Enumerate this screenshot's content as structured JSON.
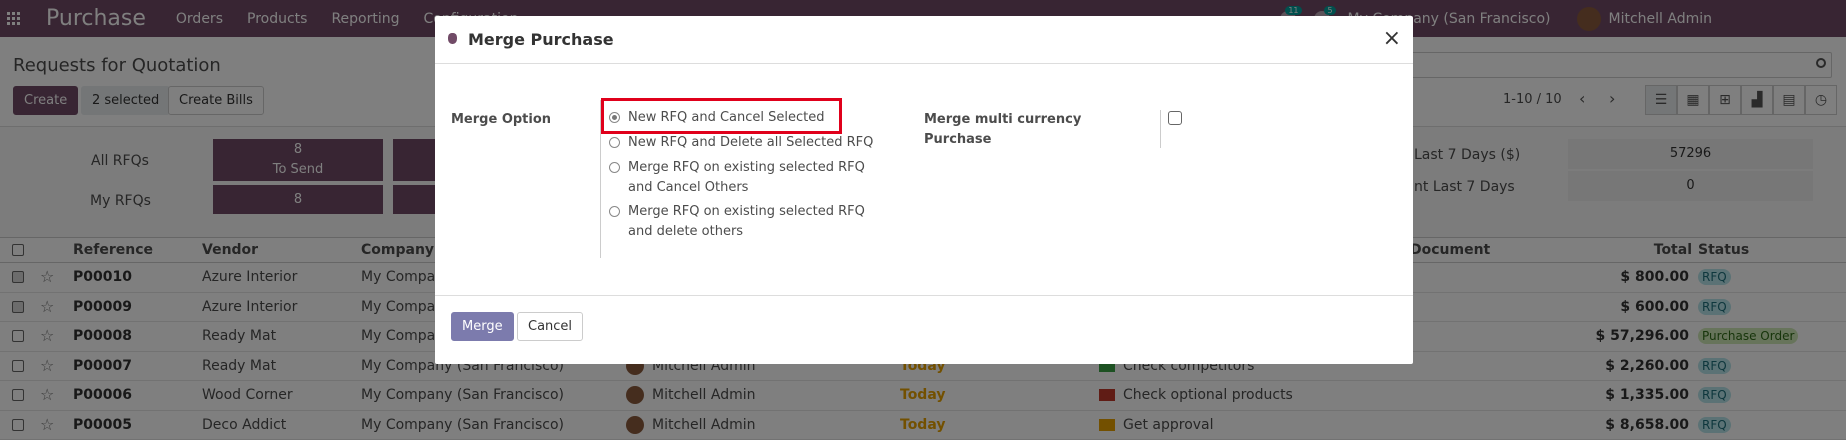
{
  "navbar": {
    "brand": "Purchase",
    "menu": [
      "Orders",
      "Products",
      "Reporting",
      "Configuration"
    ],
    "badges": [
      "11",
      "5"
    ],
    "company": "My Company (San Francisco)",
    "user": "Mitchell Admin"
  },
  "control_panel": {
    "title": "Requests for Quotation",
    "create_label": "Create",
    "selected_label": "2 selected",
    "create_bills_label": "Create Bills",
    "pager": "1-10 / 10"
  },
  "dashboard": {
    "all_rfqs": "All RFQs",
    "my_rfqs": "My RFQs",
    "to_send_count": "8",
    "to_send_label": "To Send",
    "my_to_send": "8",
    "metric1_label": "Last 7 Days ($)",
    "metric1_value": "57296",
    "metric2_label": "nt Last 7 Days",
    "metric2_value": "0"
  },
  "table": {
    "headers": {
      "reference": "Reference",
      "vendor": "Vendor",
      "company": "Company",
      "document": "Document",
      "total": "Total",
      "status": "Status"
    },
    "rows": [
      {
        "ref": "P00010",
        "vendor": "Azure Interior",
        "company": "My Compan",
        "rep": "",
        "deadline": "",
        "activity": "",
        "total": "$ 800.00",
        "status": "RFQ"
      },
      {
        "ref": "P00009",
        "vendor": "Azure Interior",
        "company": "My Compan",
        "rep": "",
        "deadline": "",
        "activity": "",
        "total": "$ 600.00",
        "status": "RFQ"
      },
      {
        "ref": "P00008",
        "vendor": "Ready Mat",
        "company": "My Compan",
        "rep": "",
        "deadline": "",
        "activity": "",
        "total": "$ 57,296.00",
        "status": "Purchase Order"
      },
      {
        "ref": "P00007",
        "vendor": "Ready Mat",
        "company": "My Company (San Francisco)",
        "rep": "Mitchell Admin",
        "deadline": "Today",
        "activity": "Check competitors",
        "total": "$ 2,260.00",
        "status": "RFQ"
      },
      {
        "ref": "P00006",
        "vendor": "Wood Corner",
        "company": "My Company (San Francisco)",
        "rep": "Mitchell Admin",
        "deadline": "Today",
        "activity": "Check optional products",
        "total": "$ 1,335.00",
        "status": "RFQ"
      },
      {
        "ref": "P00005",
        "vendor": "Deco Addict",
        "company": "My Company (San Francisco)",
        "rep": "Mitchell Admin",
        "deadline": "Today",
        "activity": "Get approval",
        "total": "$ 8,658.00",
        "status": "RFQ"
      }
    ]
  },
  "modal": {
    "title": "Merge Purchase",
    "close": "×",
    "merge_option_label": "Merge Option",
    "options": [
      {
        "line1": "New RFQ and Cancel Selected",
        "line2": ""
      },
      {
        "line1": "New RFQ and Delete all Selected RFQ",
        "line2": ""
      },
      {
        "line1": "Merge RFQ on existing selected RFQ",
        "line2": "and Cancel Others"
      },
      {
        "line1": "Merge RFQ on existing selected RFQ",
        "line2": "and delete others"
      }
    ],
    "selected_option_index": 0,
    "multi_currency_label_1": "Merge multi currency",
    "multi_currency_label_2": "Purchase",
    "multi_currency_checked": false,
    "merge_button": "Merge",
    "cancel_button": "Cancel"
  },
  "colors": {
    "brand": "#714B67",
    "highlight": "#e0001b",
    "merge_button": "#7c7bad",
    "today": "#e6a000"
  }
}
